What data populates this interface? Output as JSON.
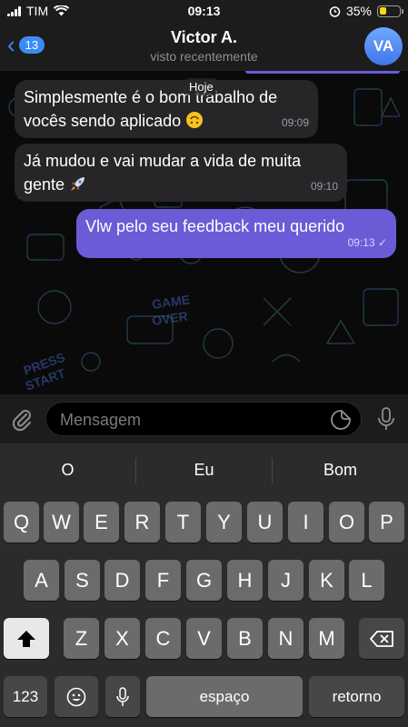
{
  "status": {
    "carrier": "TIM",
    "time": "09:13",
    "battery": "35%",
    "battery_level": 0.35
  },
  "header": {
    "back_count": "13",
    "name": "Victor A.",
    "status": "visto recentemente",
    "avatar_initials": "VA"
  },
  "chat": {
    "date_label": "Hoje",
    "messages": [
      {
        "text_line1": "Simplesmente é o bom trabalho de",
        "text_line2": "vocês sendo aplicado",
        "emoji": "upside-down-face",
        "time": "09:09"
      },
      {
        "text_line1": "Já mudou e vai mudar a vida de muita",
        "text_line2": "gente",
        "emoji": "rocket",
        "time": "09:10"
      },
      {
        "text_line1": "Vlw pelo seu feedback meu querido",
        "time": "09:13",
        "check": "✓"
      }
    ]
  },
  "input": {
    "placeholder": "Mensagem"
  },
  "keyboard": {
    "suggestions": [
      "O",
      "Eu",
      "Bom"
    ],
    "row1": [
      "Q",
      "W",
      "E",
      "R",
      "T",
      "Y",
      "U",
      "I",
      "O",
      "P"
    ],
    "row2": [
      "A",
      "S",
      "D",
      "F",
      "G",
      "H",
      "J",
      "K",
      "L"
    ],
    "row3": [
      "Z",
      "X",
      "C",
      "V",
      "B",
      "N",
      "M"
    ],
    "numbers_label": "123",
    "space_label": "espaço",
    "return_label": "retorno"
  },
  "colors": {
    "accent": "#3a8cf5",
    "outgoing_bubble": "#6b5bd6",
    "incoming_bubble": "#262628"
  }
}
